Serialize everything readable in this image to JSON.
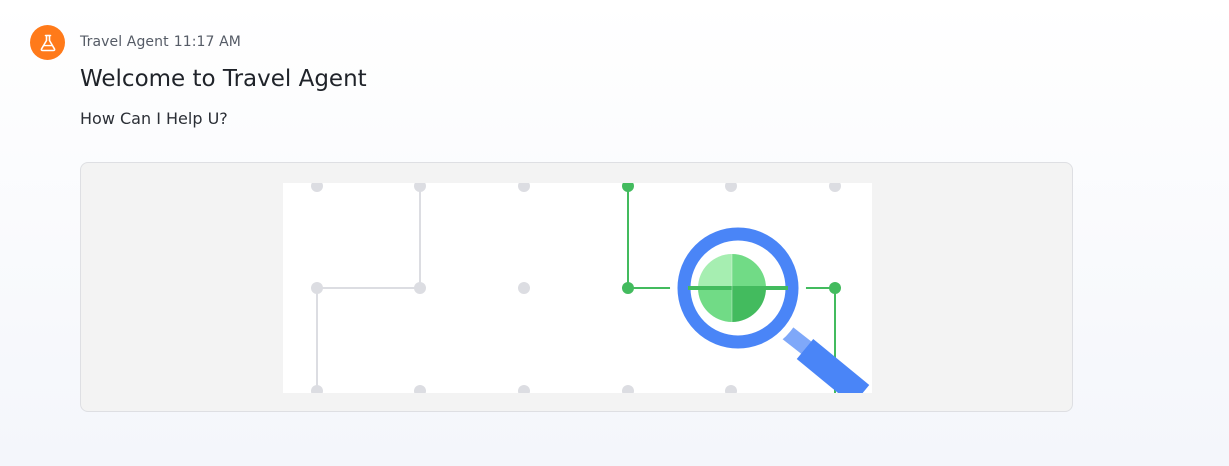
{
  "message": {
    "sender": "Travel Agent",
    "time": "11:17 AM",
    "title": "Welcome to Travel Agent",
    "body": "How Can I Help U?"
  },
  "icons": {
    "avatar": "flask-icon",
    "illustration": "magnifying-glass-network-illustration"
  },
  "colors": {
    "avatar_bg": "#ff7a1a",
    "accent_green": "#43bb5e",
    "light_green": "#a6eeb1",
    "mid_green": "#71db86",
    "lens_blue": "#4a85f7",
    "grid_gray": "#dcdde2",
    "card_bg": "#f3f3f3"
  }
}
